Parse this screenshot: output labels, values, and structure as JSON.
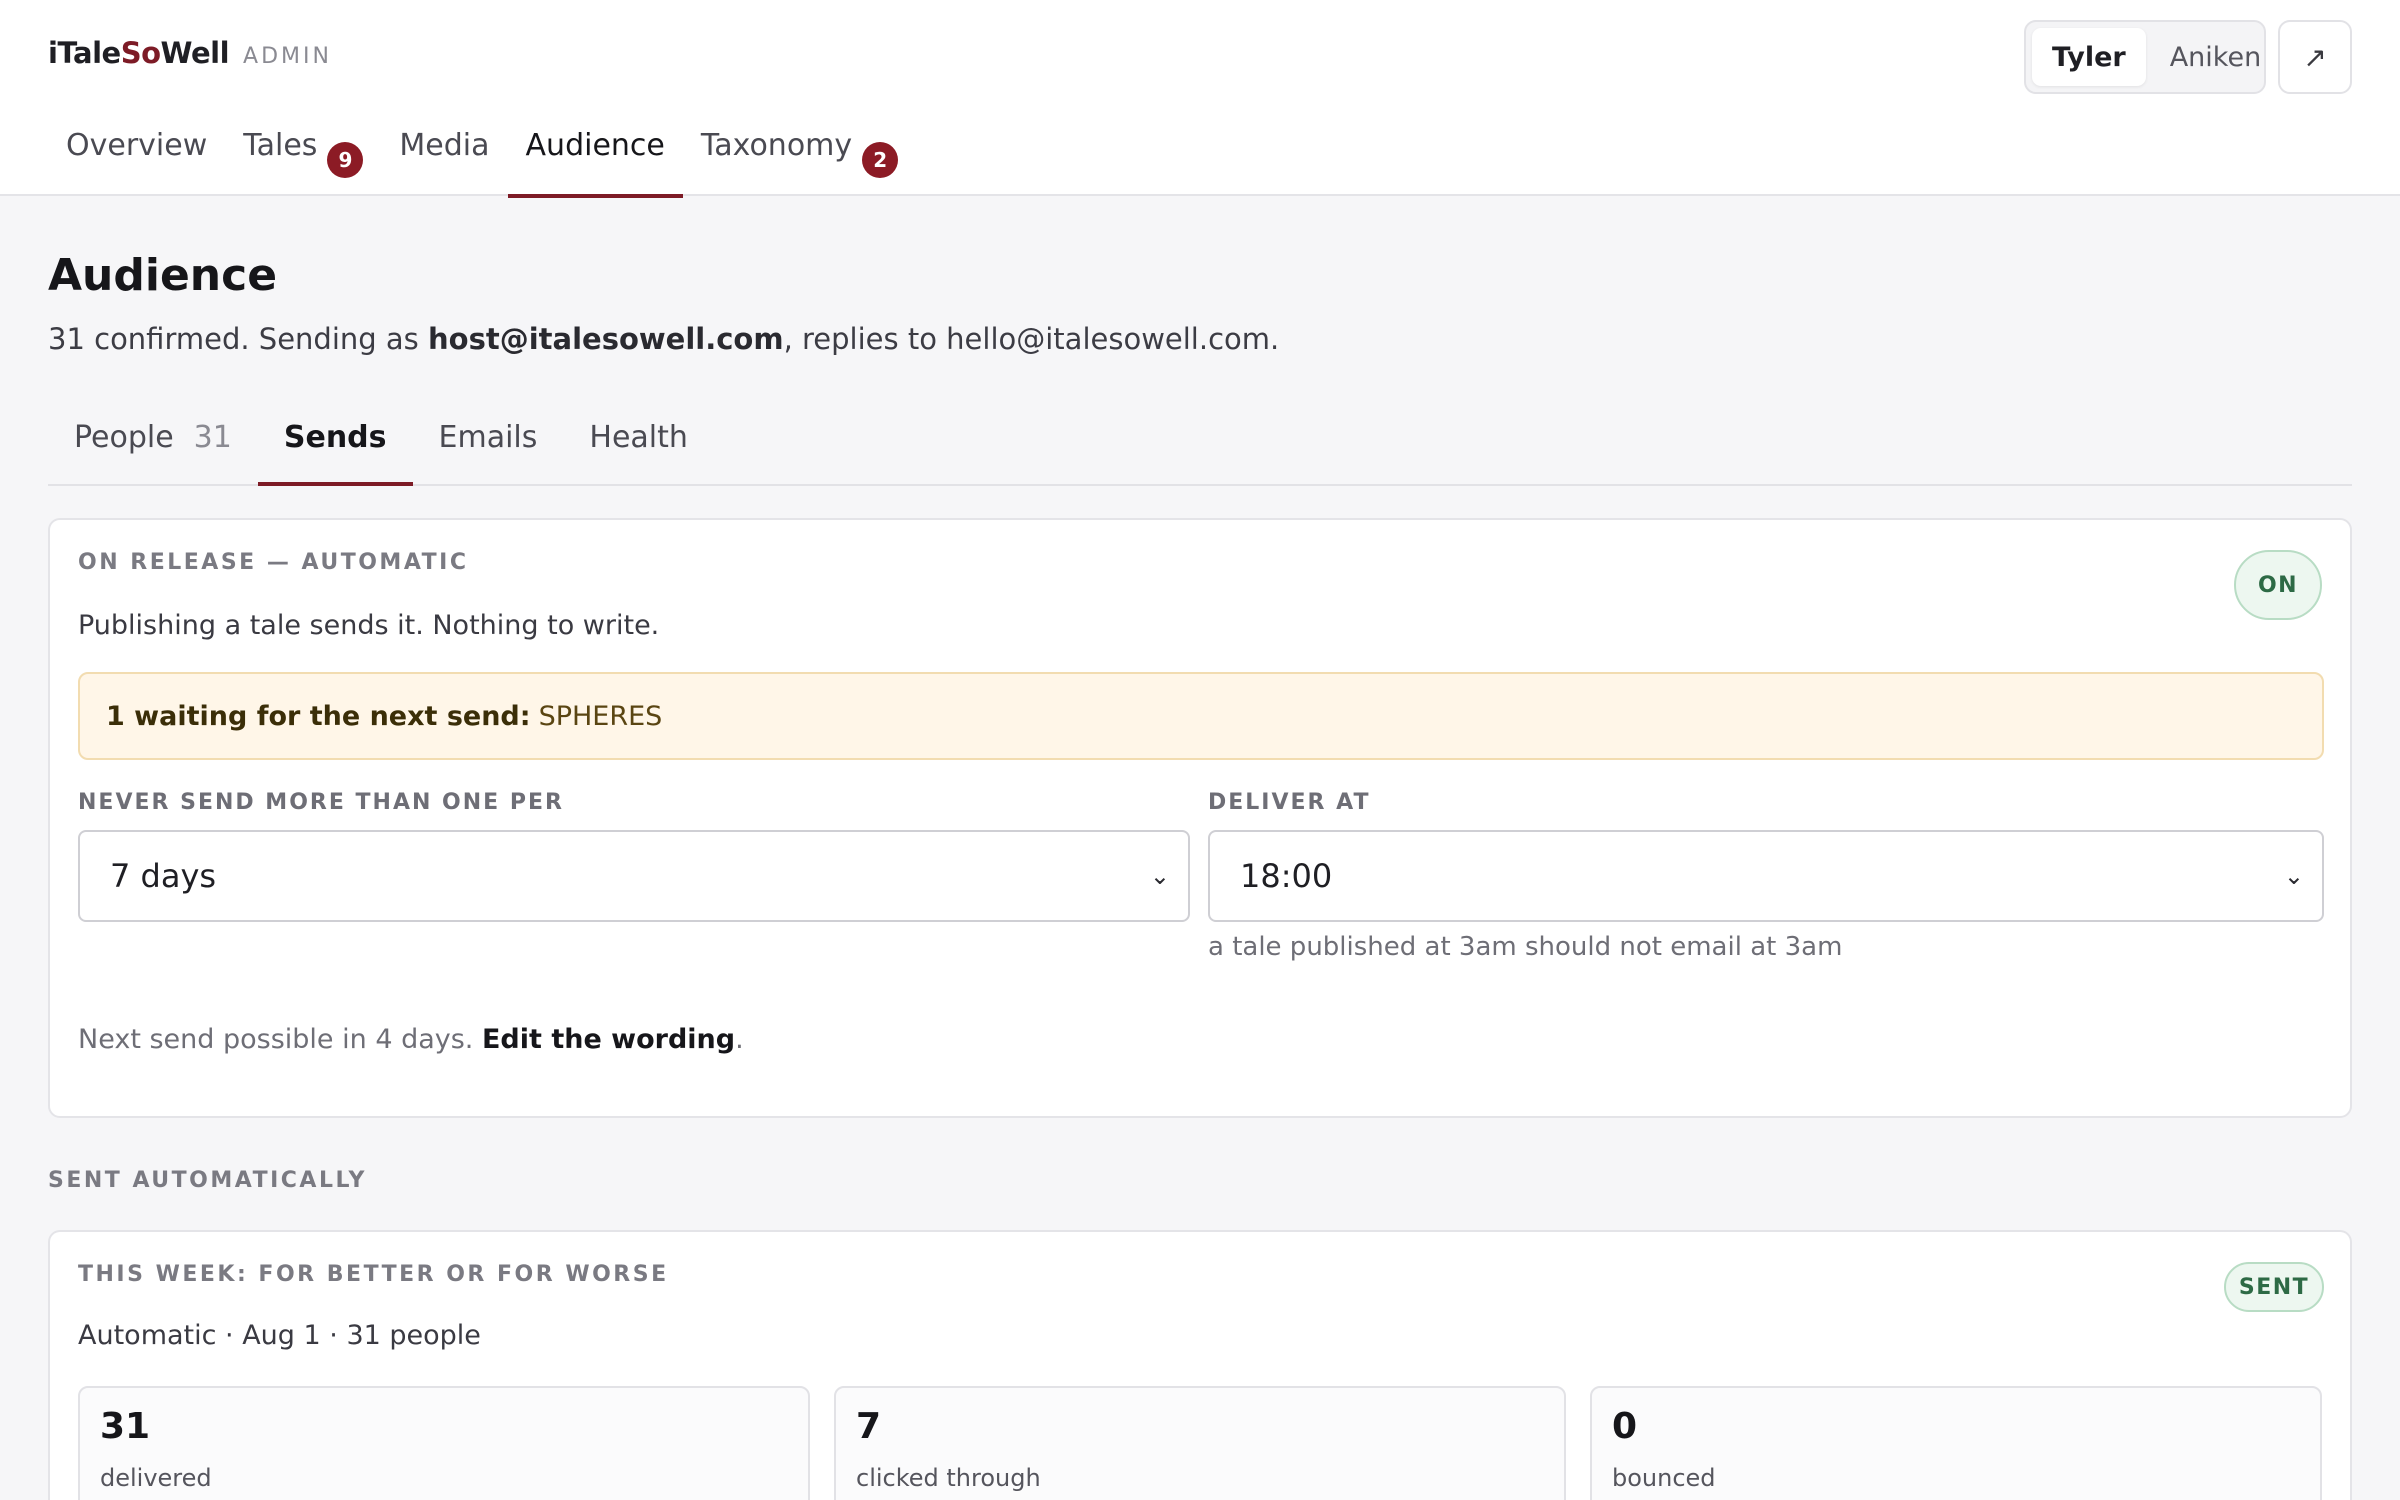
{
  "brand": {
    "name_prefix": "i",
    "name_tale": "Tale",
    "name_so": "So",
    "name_well": "Well",
    "section": "ADMIN"
  },
  "user_switch": {
    "options": [
      "Tyler",
      "Aniken"
    ],
    "active": "Tyler"
  },
  "external_link_icon": "↗",
  "main_nav": [
    {
      "label": "Overview",
      "badge": ""
    },
    {
      "label": "Tales",
      "badge": "9"
    },
    {
      "label": "Media",
      "badge": ""
    },
    {
      "label": "Audience",
      "badge": ""
    },
    {
      "label": "Taxonomy",
      "badge": "2"
    }
  ],
  "page": {
    "title": "Audience",
    "subtitle_pre": "31 confirmed. Sending as ",
    "subtitle_email": "host@italesowell.com",
    "subtitle_post": ", replies to hello@italesowell.com."
  },
  "sub_tabs": [
    {
      "label": "People",
      "count": "31"
    },
    {
      "label": "Sends",
      "count": ""
    },
    {
      "label": "Emails",
      "count": ""
    },
    {
      "label": "Health",
      "count": ""
    }
  ],
  "release": {
    "eyebrow": "ON RELEASE — AUTOMATIC",
    "description": "Publishing a tale sends it. Nothing to write.",
    "status": "ON",
    "notice_bold": "1 waiting for the next send:",
    "notice_value": "SPHERES",
    "frequency_label": "NEVER SEND MORE THAN ONE PER",
    "frequency_value": "7 days",
    "deliver_label": "DELIVER AT",
    "deliver_value": "18:00",
    "deliver_hint": "a tale published at 3am should not email at 3am",
    "next_send": "Next send possible in 4 days.",
    "edit_link": "Edit the wording",
    "edit_suffix": "."
  },
  "sent_section_label": "SENT AUTOMATICALLY",
  "sent": {
    "eyebrow": "THIS WEEK: FOR BETTER OR FOR WORSE",
    "status": "SENT",
    "meta": "Automatic · Aug 1 · 31 people",
    "stats": [
      {
        "value": "31",
        "label": "delivered"
      },
      {
        "value": "7",
        "label": "clicked through"
      },
      {
        "value": "0",
        "label": "bounced"
      }
    ]
  },
  "colors": {
    "accent": "#7d1b26",
    "badge": "#8c1b25",
    "success": "#2d6a45",
    "notice_bg": "#fff6e8"
  },
  "icons": {
    "select_chevron": "chevron-down-icon",
    "external": "external-link-icon"
  }
}
